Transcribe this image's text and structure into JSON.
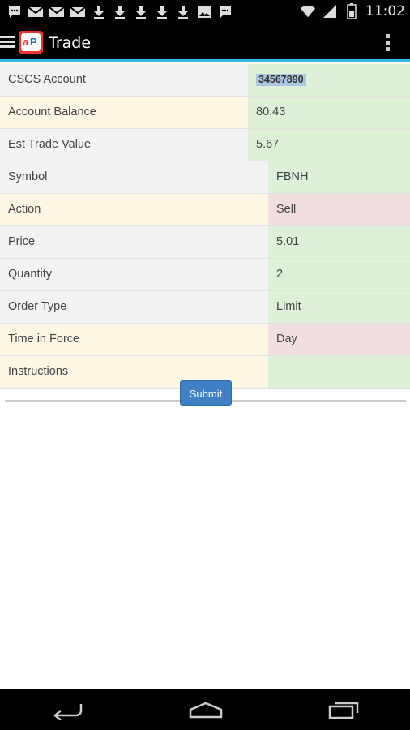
{
  "status_bar": {
    "time": "11:02",
    "icons": [
      "chat-icon",
      "mail-icon",
      "mail-icon",
      "mail-icon",
      "download-icon",
      "download-icon",
      "download-icon",
      "download-icon",
      "download-icon",
      "image-icon",
      "chat-icon"
    ],
    "right_icons": [
      "wifi-icon",
      "signal-icon",
      "battery-icon"
    ]
  },
  "action_bar": {
    "title": "Trade"
  },
  "form": {
    "rows": [
      {
        "label": "CSCS Account",
        "value": "34567890"
      },
      {
        "label": "Account Balance",
        "value": "80.43"
      },
      {
        "label": "Est Trade Value",
        "value": "5.67"
      },
      {
        "label": "Symbol",
        "value": "FBNH"
      },
      {
        "label": "Action",
        "value": "Sell"
      },
      {
        "label": "Price",
        "value": "5.01"
      },
      {
        "label": "Quantity",
        "value": "2"
      },
      {
        "label": "Order Type",
        "value": "Limit"
      },
      {
        "label": "Time in Force",
        "value": "Day"
      },
      {
        "label": "Instructions",
        "value": ""
      }
    ],
    "submit_label": "Submit"
  },
  "colors": {
    "accent": "#33b5e5",
    "label_gray": "#f3f3f3",
    "label_yellow": "#fdf7e3",
    "value_green": "#dff0d8",
    "value_red": "#f2dede",
    "button": "#3f7fc6"
  }
}
